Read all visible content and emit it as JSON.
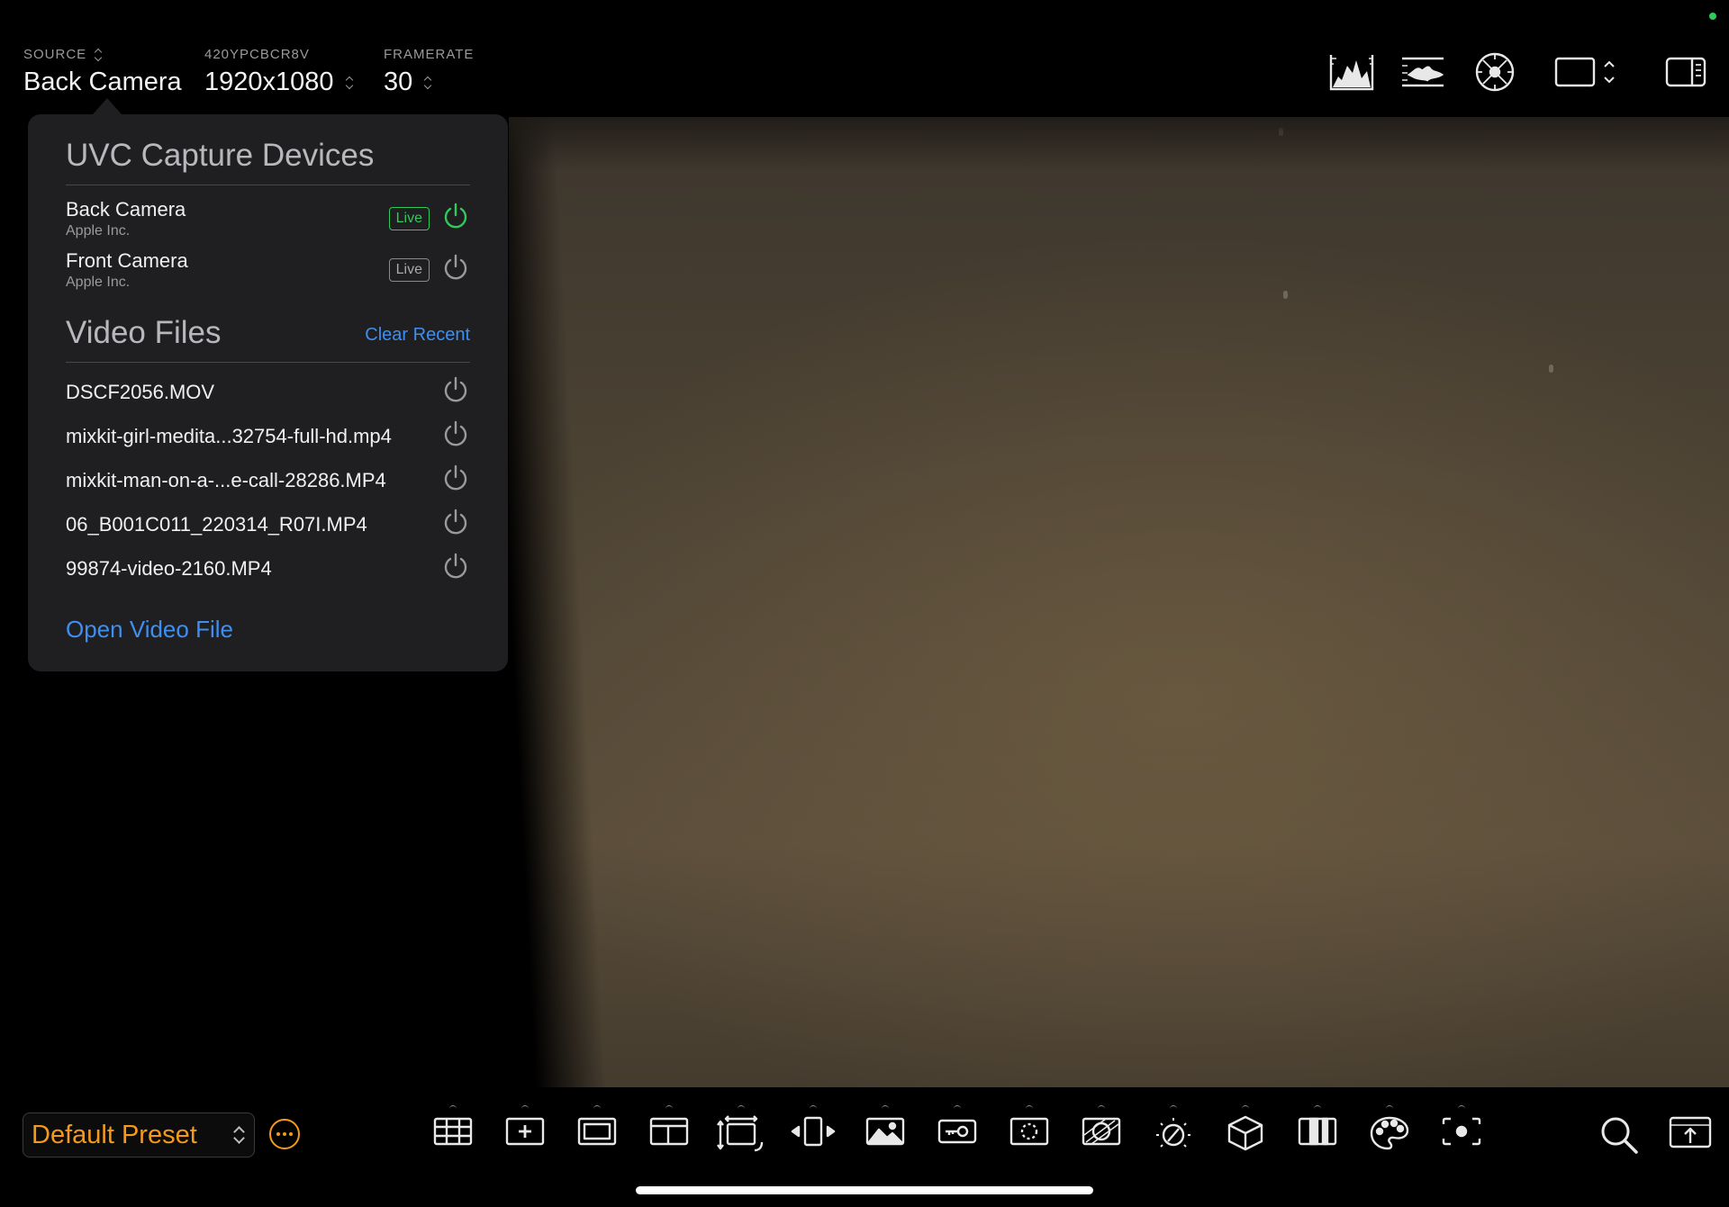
{
  "topbar": {
    "source": {
      "caption": "SOURCE",
      "value": "Back Camera"
    },
    "format": {
      "caption": "420YPCBCR8V",
      "value": "1920x1080"
    },
    "framerate": {
      "caption": "FRAMERATE",
      "value": "30"
    },
    "tools": [
      "histogram-icon",
      "waveform-icon",
      "vectorscope-icon",
      "aspect-ratio-icon",
      "sidebar-toggle-icon"
    ]
  },
  "popover": {
    "uvc_title": "UVC Capture Devices",
    "devices": [
      {
        "name": "Back Camera",
        "maker": "Apple Inc.",
        "badge": "Live",
        "active": true
      },
      {
        "name": "Front Camera",
        "maker": "Apple Inc.",
        "badge": "Live",
        "active": false
      }
    ],
    "files_title": "Video Files",
    "clear_label": "Clear Recent",
    "files": [
      "DSCF2056.MOV",
      "mixkit-girl-medita...32754-full-hd.mp4",
      "mixkit-man-on-a-...e-call-28286.MP4",
      "06_B001C011_220314_R07I.MP4",
      "99874-video-2160.MP4"
    ],
    "open_label": "Open Video File"
  },
  "bottombar": {
    "preset": "Default Preset",
    "tools": [
      "grid-icon",
      "crosshair-icon",
      "frame-guide-icon",
      "safe-area-icon",
      "transform-icon",
      "flip-icon",
      "image-overlay-icon",
      "key-icon",
      "focus-peaking-icon",
      "false-color-icon",
      "exposure-icon",
      "lut-cube-icon",
      "zebra-icon",
      "palette-icon",
      "spot-meter-icon"
    ],
    "right_tools": [
      "search-icon",
      "share-icon"
    ]
  },
  "colors": {
    "accent": "#f39a1c",
    "link": "#3d8ff0",
    "live": "#30c95a",
    "panel": "#1f1f22"
  }
}
